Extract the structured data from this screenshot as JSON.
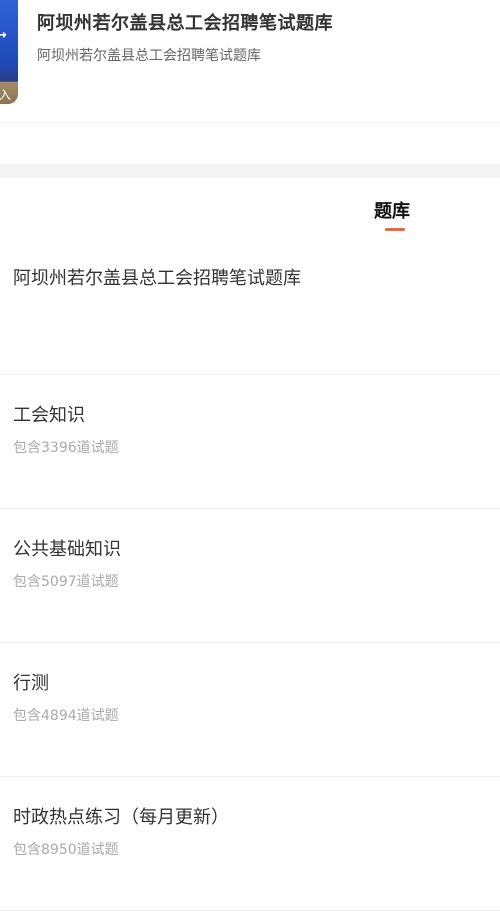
{
  "header": {
    "thumbnail_label": "入",
    "thumbnail_mark": "→",
    "title": "阿坝州若尔盖县总工会招聘笔试题库",
    "subtitle": "阿坝州若尔盖县总工会招聘笔试题库"
  },
  "tabs": [
    {
      "label": "题库",
      "active": true
    }
  ],
  "bank": {
    "title": "阿坝州若尔盖县总工会招聘笔试题库"
  },
  "items": [
    {
      "name": "工会知识",
      "count_text": "包含3396道试题"
    },
    {
      "name": "公共基础知识",
      "count_text": "包含5097道试题"
    },
    {
      "name": "行测",
      "count_text": "包含4894道试题"
    },
    {
      "name": "时政热点练习（每月更新）",
      "count_text": "包含8950道试题"
    }
  ],
  "colors": {
    "accent": "#e86a3c",
    "thumbnail_blue": "#1f49b8",
    "muted_text": "#aaaaaa"
  }
}
